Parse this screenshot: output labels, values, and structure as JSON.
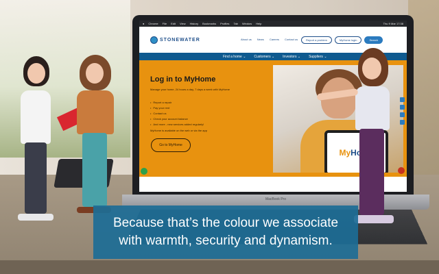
{
  "menubar": {
    "items": [
      "Chrome",
      "File",
      "Edit",
      "View",
      "History",
      "Bookmarks",
      "Profiles",
      "Tab",
      "Window",
      "Help"
    ],
    "clock": "Thu 9 Mar  17:38"
  },
  "site": {
    "logo_text": "STONEWATER",
    "top_nav": [
      "About us",
      "News",
      "Careers",
      "Contact us"
    ],
    "buttons": {
      "report": "Report a problem",
      "myhome": "MyHome login",
      "search": "Search"
    },
    "sub_nav": [
      "Find a home",
      "Customers",
      "Investors",
      "Suppliers"
    ]
  },
  "hero": {
    "title": "Log in to MyHome",
    "subtitle": "Manage your home, 24 hours a day, 7 days a week with MyHome",
    "bullets": [
      "Report a repair",
      "Pay your rent",
      "Contact us",
      "Check your account balance",
      "And more - new services added regularly!"
    ],
    "note": "MyHome is available on the web or via the app",
    "button": "Go to MyHome",
    "tablet_my": "My",
    "tablet_home": "Home"
  },
  "laptop": {
    "label": "MacBook Pro"
  },
  "caption": {
    "line1": "Because that’s the colour we associate",
    "line2": "with warmth, security and dynamism."
  },
  "colors": {
    "brand_orange": "#e8920f",
    "brand_navy": "#0f5a8f",
    "caption_bg": "#1c6d96"
  }
}
